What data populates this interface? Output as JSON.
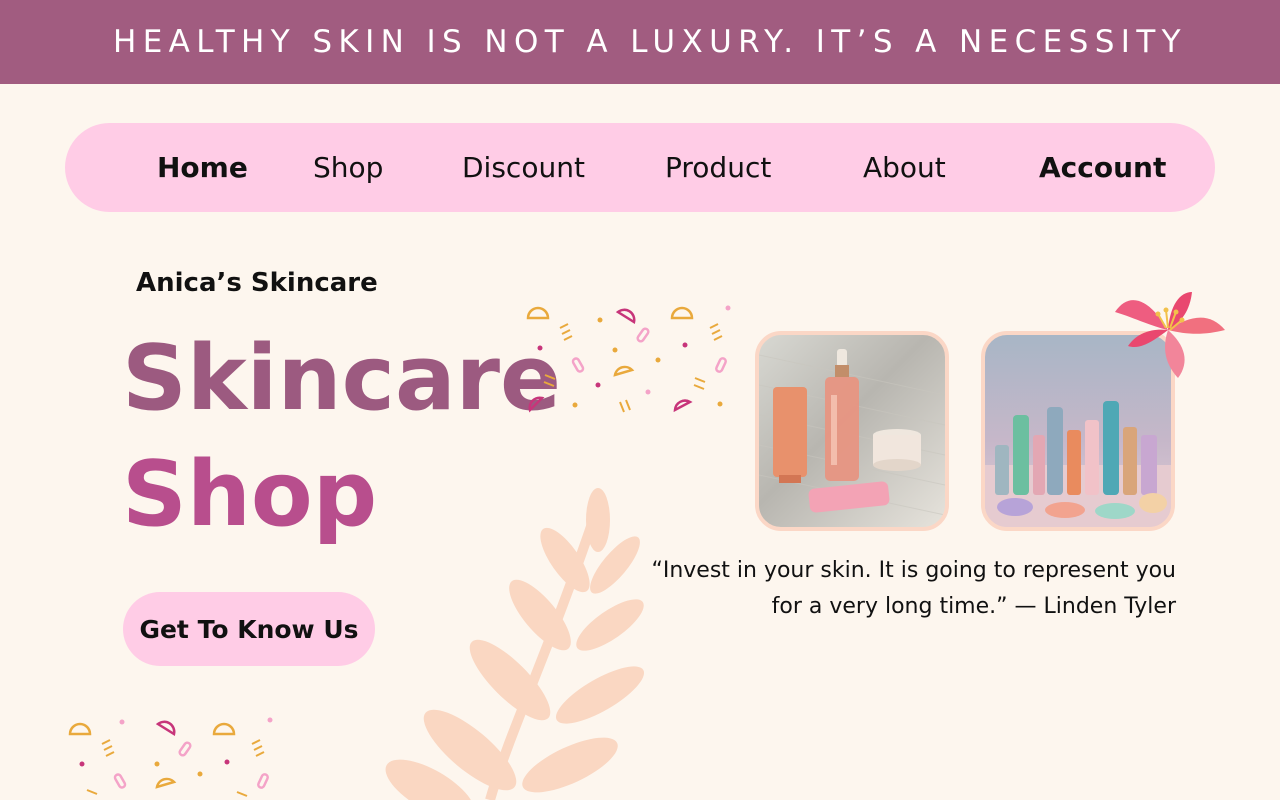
{
  "banner": {
    "text": "HEALTHY SKIN IS NOT A LUXURY. IT’S A NECESSITY"
  },
  "nav": {
    "items": [
      {
        "label": "Home",
        "bold": true
      },
      {
        "label": "Shop",
        "bold": false
      },
      {
        "label": "Discount",
        "bold": false
      },
      {
        "label": "Product",
        "bold": false
      },
      {
        "label": "About",
        "bold": false
      },
      {
        "label": "Account",
        "bold": true
      }
    ]
  },
  "hero": {
    "brand": "Anica’s Skincare",
    "title_line1": "Skincare",
    "title_line2": "Shop",
    "cta_label": "Get To Know Us"
  },
  "quote": {
    "text": "“Invest in your skin. It is going to represent you for a very long time.” — Linden Tyler"
  },
  "colors": {
    "banner_bg": "#a15c80",
    "nav_bg": "#ffcce6",
    "page_bg": "#fdf6ee",
    "title_mauve": "#9c5a80",
    "title_magenta": "#b84e8d",
    "leaf": "#fad7c2",
    "flower": "#ee5d80"
  },
  "images": [
    {
      "name": "skincare-bottles-photo"
    },
    {
      "name": "cosmetics-collection-photo"
    }
  ]
}
